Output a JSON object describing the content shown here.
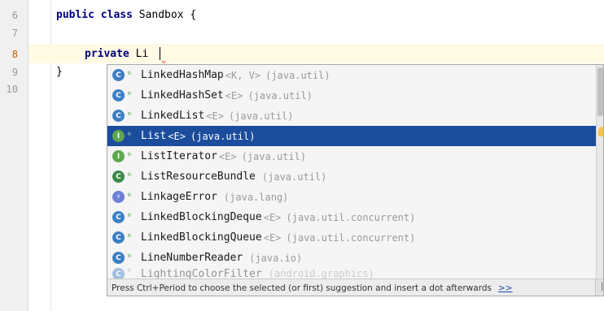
{
  "editor": {
    "line_numbers": [
      "6",
      "7",
      "8",
      "9",
      "10"
    ],
    "current_line": "8",
    "lines": {
      "l6": {
        "keywords": "public class",
        "rest": " Sandbox {"
      },
      "l8": {
        "keyword": "private",
        "rest": " Li"
      },
      "l9": {
        "rest": "}"
      }
    }
  },
  "completion": {
    "items": [
      {
        "kind": "C",
        "kind_icon": "class-icon",
        "name": "LinkedHashMap",
        "type_params": "<K, V>",
        "package": "(java.util)"
      },
      {
        "kind": "C",
        "kind_icon": "class-icon",
        "name": "LinkedHashSet",
        "type_params": "<E>",
        "package": "(java.util)"
      },
      {
        "kind": "C",
        "kind_icon": "class-icon",
        "name": "LinkedList",
        "type_params": "<E>",
        "package": "(java.util)"
      },
      {
        "kind": "I",
        "kind_icon": "interface-icon",
        "name": "List",
        "type_params": "<E>",
        "package": "(java.util)",
        "selected": true
      },
      {
        "kind": "I",
        "kind_icon": "interface-icon",
        "name": "ListIterator",
        "type_params": "<E>",
        "package": "(java.util)"
      },
      {
        "kind": "C",
        "kind_icon": "abstract-class-icon",
        "name": "ListResourceBundle",
        "type_params": "",
        "package": "(java.util)"
      },
      {
        "kind": "⚡",
        "kind_icon": "error-class-icon",
        "name": "LinkageError",
        "type_params": "",
        "package": "(java.lang)"
      },
      {
        "kind": "C",
        "kind_icon": "class-icon",
        "name": "LinkedBlockingDeque",
        "type_params": "<E>",
        "package": "(java.util.concurrent)"
      },
      {
        "kind": "C",
        "kind_icon": "class-icon",
        "name": "LinkedBlockingQueue",
        "type_params": "<E>",
        "package": "(java.util.concurrent)"
      },
      {
        "kind": "C",
        "kind_icon": "class-icon",
        "name": "LineNumberReader",
        "type_params": "",
        "package": "(java.io)"
      },
      {
        "kind": "C",
        "kind_icon": "class-icon",
        "name": "LightingColorFilter",
        "type_params": "",
        "package": "(android.graphics)"
      }
    ],
    "hint_text": "Press Ctrl+Period to choose the selected (or first) suggestion and insert a dot afterwards",
    "hint_link": ">>"
  },
  "colors": {
    "selection": "#1c4d9c",
    "class_icon": "#3c7fc5",
    "interface_icon": "#5ea84e",
    "keyword": "#000080",
    "current_line": "#fffae3"
  }
}
